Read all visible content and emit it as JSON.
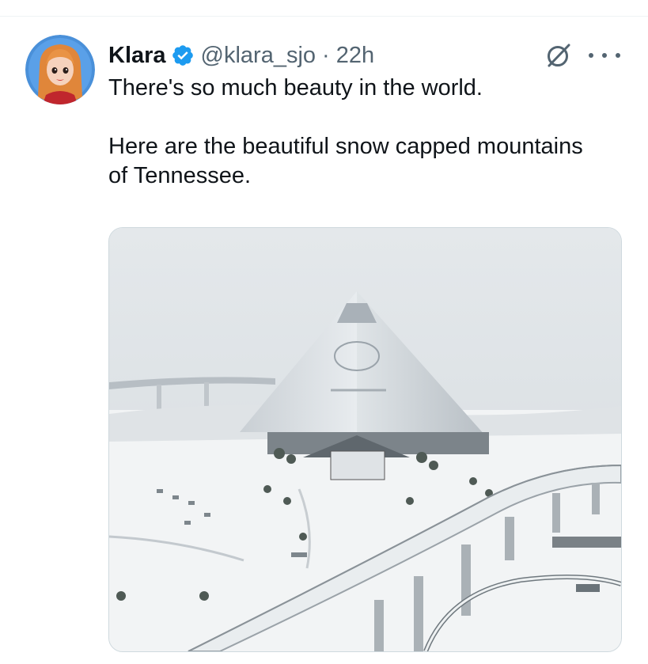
{
  "tweet": {
    "author": {
      "display_name": "Klara",
      "handle": "@klara_sjo",
      "verified": true,
      "avatar_icon": "cartoon-woman-avatar"
    },
    "separator": "·",
    "timestamp": "22h",
    "text": {
      "line1": "There's so much beauty in the world.",
      "line2": "Here are the beautiful snow capped mountains of Tennessee."
    },
    "media": {
      "alt": "Aerial photo of a snow-covered glass pyramid building with a curving elevated highway"
    },
    "actions": {
      "grok_icon": "grok-icon",
      "more_icon": "more-options-icon"
    }
  },
  "colors": {
    "text_primary": "#0f1419",
    "text_secondary": "#536471",
    "verified_blue": "#1d9bf0",
    "border": "#cfd9de"
  }
}
